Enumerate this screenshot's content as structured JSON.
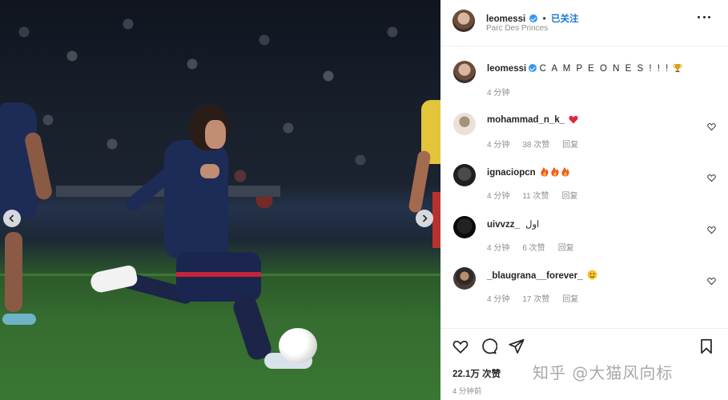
{
  "post": {
    "author": "leomessi",
    "follow_status": "已关注",
    "location": "Parc Des Princes",
    "dot": "•"
  },
  "caption": {
    "author": "leomessi",
    "text": "C A M P E O N E S ! ! !",
    "emoji": "trophy-icon",
    "time": "4 分钟"
  },
  "comments": [
    {
      "user": "mohammad_n_k_",
      "text": "",
      "emoji": "red-heart",
      "time": "4 分钟",
      "likes": "38 次赞",
      "reply": "回复"
    },
    {
      "user": "ignaciopcn",
      "text": "",
      "emoji": "fire-x3",
      "time": "4 分钟",
      "likes": "11 次赞",
      "reply": "回复"
    },
    {
      "user": "uivvzz_",
      "text": "اول",
      "emoji": "",
      "time": "4 分钟",
      "likes": "6 次赞",
      "reply": "回复"
    },
    {
      "user": "_blaugrana__forever_",
      "text": "",
      "emoji": "yellow-face",
      "time": "4 分钟",
      "likes": "17 次赞",
      "reply": "回复"
    }
  ],
  "actions": {
    "likes": "22.1万 次赞",
    "time_ago": "4 分钟前"
  },
  "watermark": "知乎 @大猫风向标",
  "colors": {
    "accent": "#1877d4",
    "verified": "#3897f0",
    "heart": "#ed4956",
    "muted": "#8e8e8e"
  }
}
